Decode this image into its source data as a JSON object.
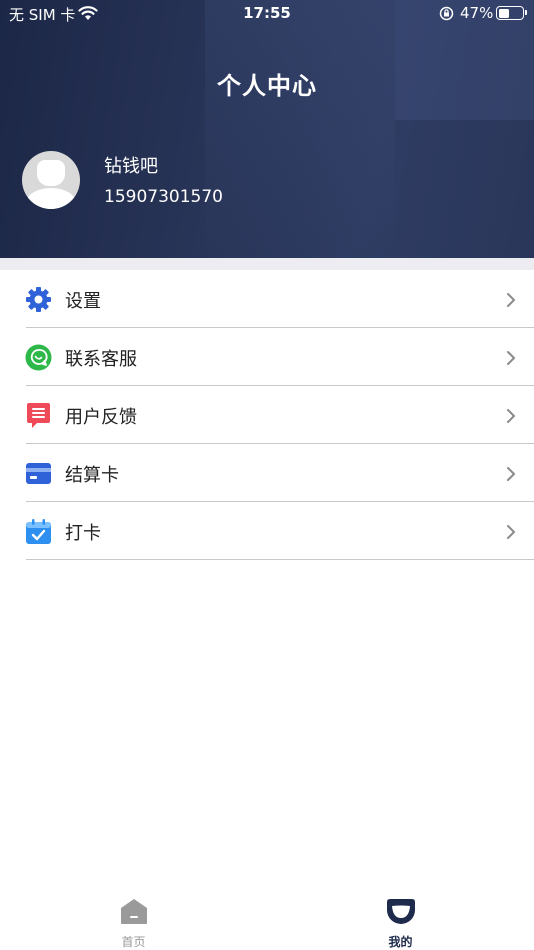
{
  "status_bar": {
    "carrier": "无 SIM 卡",
    "time": "17:55",
    "battery": "47%",
    "battery_level": 0.47
  },
  "header": {
    "title": "个人中心",
    "user_name": "钻钱吧",
    "phone": "15907301570"
  },
  "menu": [
    {
      "label": "设置",
      "icon": "gear-icon",
      "color": "#2f62d8"
    },
    {
      "label": "联系客服",
      "icon": "chat-icon",
      "color": "#2fb84a"
    },
    {
      "label": "用户反馈",
      "icon": "feedback-icon",
      "color": "#ee4a5a"
    },
    {
      "label": "结算卡",
      "icon": "card-icon",
      "color": "#2f62d8"
    },
    {
      "label": "打卡",
      "icon": "calendar-check-icon",
      "color": "#2d8ff0"
    }
  ],
  "tabbar": {
    "home_label": "首页",
    "mine_label": "我的",
    "active": "mine"
  },
  "colors": {
    "header_bg": "#283457",
    "active_tab": "#1f2b4d",
    "inactive_tab": "#999999"
  }
}
